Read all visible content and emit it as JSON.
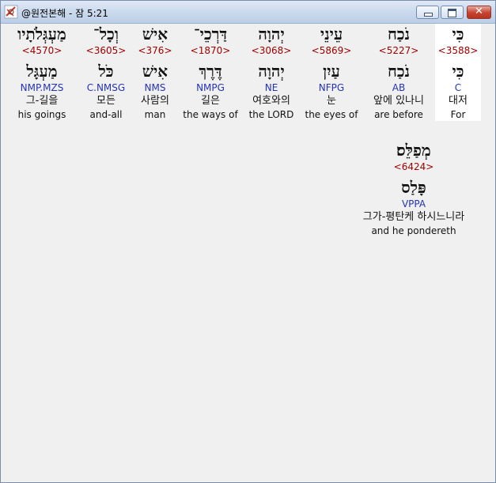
{
  "window": {
    "title": "@원전본해 - 잠 5:21"
  },
  "words": [
    {
      "hebrew": "כִּי",
      "strong": "<3588>",
      "lemma": "כִּי",
      "morph": "C",
      "korean": "대저",
      "english": "For"
    },
    {
      "hebrew": "נֹכַח",
      "strong": "<5227>",
      "lemma": "נֹכַח",
      "morph": "AB",
      "korean": "앞에 있나니",
      "english": "are before"
    },
    {
      "hebrew": "עֵינֵי",
      "strong": "<5869>",
      "lemma": "עַיִן",
      "morph": "NFPG",
      "korean": "눈",
      "english": "the eyes of"
    },
    {
      "hebrew": "יְהוָה",
      "strong": "<3068>",
      "lemma": "יְהוָה",
      "morph": "NE",
      "korean": "여호와의",
      "english": "the LORD"
    },
    {
      "hebrew": "דַּרְכֵי־",
      "strong": "<1870>",
      "lemma": "דֶּרֶךְ",
      "morph": "NMPG",
      "korean": "길은",
      "english": "the ways of"
    },
    {
      "hebrew": "אִישׁ",
      "strong": "<376>",
      "lemma": "אִישׁ",
      "morph": "NMS",
      "korean": "사람의",
      "english": "man"
    },
    {
      "hebrew": "וְכָל־",
      "strong": "<3605>",
      "lemma": "כֹּל",
      "morph": "C.NMSG",
      "korean": "모든",
      "english": "and-all"
    },
    {
      "hebrew": "מַעְגְּלֹתָיו",
      "strong": "<4570>",
      "lemma": "מַעְגָּל",
      "morph": "NMP.MZS",
      "korean": "그-길을",
      "english": "his goings"
    },
    {
      "hebrew": "מְפַלֵּס׃",
      "strong": "<6424>",
      "lemma": "פָּלַס",
      "morph": "VPPA",
      "korean": "그가-평탄케 하시느니라",
      "english": "and he pondereth"
    }
  ]
}
